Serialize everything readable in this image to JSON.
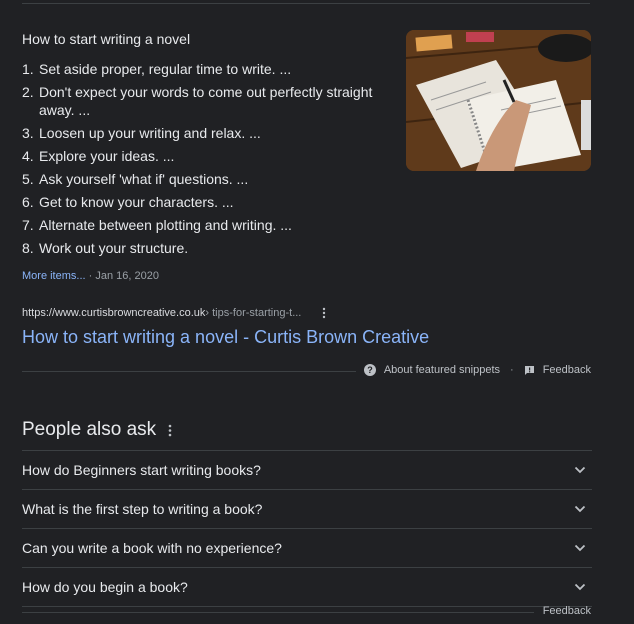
{
  "snippet": {
    "title": "How to start writing a novel",
    "items": [
      {
        "num": "1.",
        "text": "Set aside proper, regular time to write. ..."
      },
      {
        "num": "2.",
        "text": "Don't expect your words to come out perfectly straight away. ..."
      },
      {
        "num": "3.",
        "text": "Loosen up your writing and relax. ..."
      },
      {
        "num": "4.",
        "text": "Explore your ideas. ..."
      },
      {
        "num": "5.",
        "text": "Ask yourself 'what if' questions. ..."
      },
      {
        "num": "6.",
        "text": "Get to know your characters. ..."
      },
      {
        "num": "7.",
        "text": "Alternate between plotting and writing. ..."
      },
      {
        "num": "8.",
        "text": "Work out your structure."
      }
    ],
    "more_items": "More items...",
    "separator": "·",
    "date": "Jan 16, 2020"
  },
  "result": {
    "domain": "https://www.curtisbrowncreative.co.uk",
    "path": " › tips-for-starting-t...",
    "link_title": "How to start writing a novel - Curtis Brown Creative"
  },
  "snippet_footer": {
    "about": "About featured snippets",
    "separator": "·",
    "feedback": "Feedback"
  },
  "people_also_ask": {
    "title": "People also ask",
    "questions": [
      "How do Beginners start writing books?",
      "What is the first step to writing a book?",
      "Can you write a book with no experience?",
      "How do you begin a book?"
    ],
    "feedback": "Feedback"
  },
  "colors": {
    "background": "#202124",
    "link": "#8ab4f8",
    "text": "#e8eaed",
    "muted": "#9aa0a6",
    "divider": "#3c4043"
  },
  "icons": {
    "kebab": "more-vert-icon",
    "chevron": "chevron-down-icon",
    "help": "help-circle-icon",
    "feedback": "feedback-icon"
  }
}
